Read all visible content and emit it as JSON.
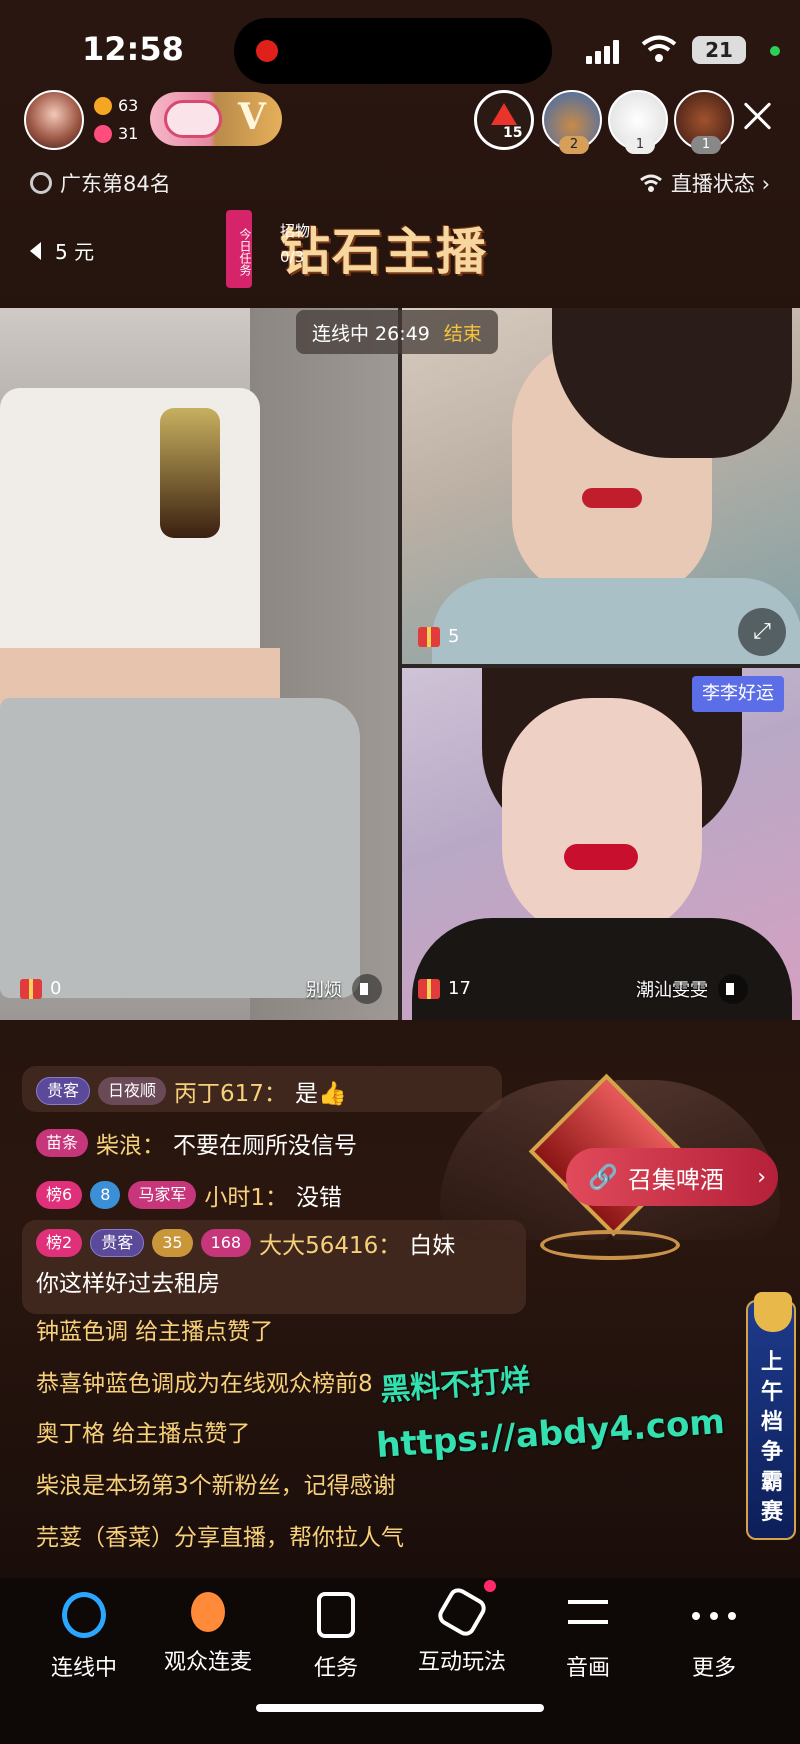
{
  "status_bar": {
    "time": "12:58",
    "battery": "21"
  },
  "anchor": {
    "fans": "63",
    "likes": "31",
    "badge_letter": "V"
  },
  "rank_badge": {
    "count": "15"
  },
  "viewers": [
    {
      "badge": "2"
    },
    {
      "badge": "1"
    },
    {
      "badge": "1"
    }
  ],
  "region_rank": "广东第84名",
  "live_status": "直播状态 ›",
  "money": "5 元",
  "daily_task": {
    "tag": "今日任务",
    "title": "钻石主播",
    "sub": "招物",
    "count": "0/3"
  },
  "link_bar": {
    "timer_label": "连线中 26:49",
    "end_label": "结束"
  },
  "streams": {
    "left": {
      "gifts": "0",
      "name": "别烦"
    },
    "right_top": {
      "gifts": "5"
    },
    "right_bottom": {
      "gifts": "17",
      "name": "潮汕雯雯",
      "tag": "李李好运"
    }
  },
  "chat": [
    {
      "tags": [
        "贵客",
        "日夜顺"
      ],
      "name": "丙丁617：",
      "text": "是👍"
    },
    {
      "tags": [
        "苗条"
      ],
      "name": "柴浪：",
      "text": "不要在厕所没信号"
    },
    {
      "tags": [
        "榜6",
        "8",
        "马家军"
      ],
      "name": "小时1：",
      "text": "没错"
    },
    {
      "tags": [
        "榜2",
        "贵客",
        "35",
        "168"
      ],
      "name": "大大56416：",
      "text": "白妹",
      "text2": "你这样好过去租房"
    }
  ],
  "system_messages": [
    "钟蓝色调 给主播点赞了",
    "恭喜钟蓝色调成为在线观众榜前8",
    "奥丁格 给主播点赞了",
    "柴浪是本场第3个新粉丝，记得感谢",
    "芫荽（香菜）分享直播，帮你拉人气"
  ],
  "summon_button": "召集啤酒",
  "contest": "上午档争霸赛",
  "watermark": {
    "line1": "黑料不打烊",
    "line2": "https://abdy4.com"
  },
  "toolbar": [
    {
      "label": "连线中"
    },
    {
      "label": "观众连麦"
    },
    {
      "label": "任务"
    },
    {
      "label": "互动玩法"
    },
    {
      "label": "音画"
    },
    {
      "label": "更多"
    }
  ]
}
